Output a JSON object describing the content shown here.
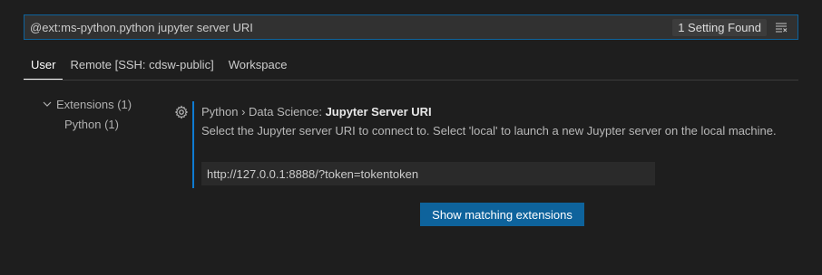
{
  "search": {
    "value": "@ext:ms-python.python jupyter server URI",
    "count": "1 Setting Found",
    "clear_icon": "clear-filter-icon"
  },
  "tabs": [
    {
      "label": "User",
      "active": true
    },
    {
      "label": "Remote [SSH: cdsw-public]",
      "active": false
    },
    {
      "label": "Workspace",
      "active": false
    }
  ],
  "toc": {
    "extensions_label": "Extensions (1)",
    "python_label": "Python (1)"
  },
  "setting": {
    "category": "Python › Data Science: ",
    "label": "Jupyter Server URI",
    "description": "Select the Jupyter server URI to connect to. Select 'local' to launch a new Juypter server on the local machine.",
    "value": "http://127.0.0.1:8888/?token=tokentoken"
  },
  "button": {
    "label": "Show matching extensions"
  },
  "colors": {
    "accent": "#0e639c",
    "focus_border": "#0e7bd1",
    "background": "#1e1e1e"
  }
}
